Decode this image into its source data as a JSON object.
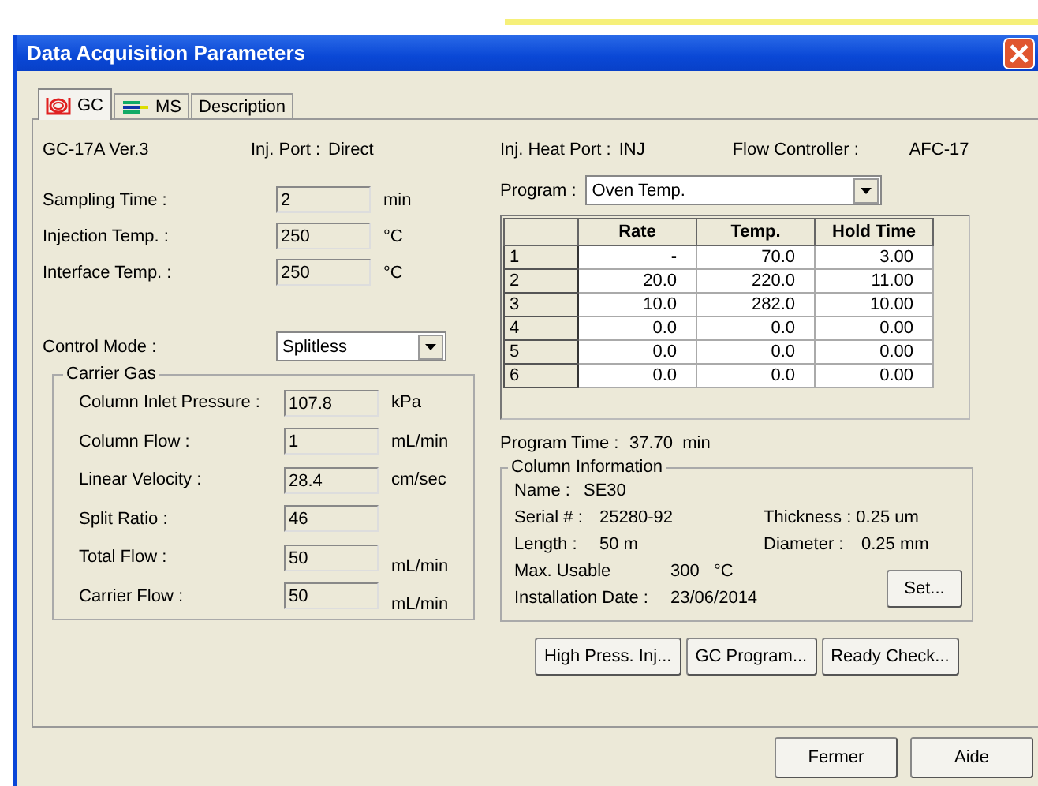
{
  "window": {
    "title": "Data Acquisition Parameters"
  },
  "tabs": [
    {
      "label": "GC",
      "kind": "gc",
      "selected": true
    },
    {
      "label": "MS",
      "kind": "ms",
      "selected": false
    },
    {
      "label": "Description",
      "kind": "text",
      "selected": false
    }
  ],
  "header": {
    "model": "GC-17A Ver.3",
    "inj_port_label": "Inj. Port :",
    "inj_port": "Direct",
    "heat_port_label": "Inj. Heat Port :",
    "heat_port": "INJ",
    "flow_controller_label": "Flow Controller :",
    "flow_controller": "AFC-17"
  },
  "fields": [
    {
      "label": "Sampling Time :",
      "value": "2",
      "unit": "min"
    },
    {
      "label": "Injection Temp. :",
      "value": "250",
      "unit": "°C"
    },
    {
      "label": "Interface Temp. :",
      "value": "250",
      "unit": "°C"
    }
  ],
  "control_mode": {
    "label": "Control Mode :",
    "value": "Splitless"
  },
  "carrier_gas": {
    "title": "Carrier Gas",
    "fields": [
      {
        "label": "Column Inlet Pressure :",
        "value": "107.8",
        "unit": "kPa"
      },
      {
        "label": "Column Flow :",
        "value": "1",
        "unit": "mL/min"
      },
      {
        "label": "Linear Velocity :",
        "value": "28.4",
        "unit": "cm/sec"
      },
      {
        "label": "Split Ratio :",
        "value": "46"
      },
      {
        "label": "Total Flow :",
        "value": "50",
        "unit": "mL/min"
      },
      {
        "label": "Carrier Flow :",
        "value": "50",
        "unit": "mL/min"
      }
    ]
  },
  "program": {
    "label": "Program :",
    "value": "Oven Temp."
  },
  "table": {
    "columns": [
      "Rate",
      "Temp.",
      "Hold Time"
    ],
    "rows": [
      {
        "index": "1",
        "cells": [
          "-",
          "70.0",
          "3.00"
        ]
      },
      {
        "index": "2",
        "cells": [
          "20.0",
          "220.0",
          "11.00"
        ]
      },
      {
        "index": "3",
        "cells": [
          "10.0",
          "282.0",
          "10.00"
        ]
      },
      {
        "index": "4",
        "cells": [
          "0.0",
          "0.0",
          "0.00"
        ]
      },
      {
        "index": "5",
        "cells": [
          "0.0",
          "0.0",
          "0.00"
        ]
      },
      {
        "index": "6",
        "cells": [
          "0.0",
          "0.0",
          "0.00"
        ]
      }
    ]
  },
  "program_time": {
    "label": "Program Time :",
    "value": "37.70  min"
  },
  "column_information": {
    "title": "Column Information",
    "name_label": "Name :",
    "name": "SE30",
    "serial_label": "Serial # :",
    "serial": "25280-92",
    "thickness": "Thickness : 0.25 um",
    "length_label": "Length :",
    "length": "50 m",
    "diameter_label": "Diameter :",
    "diameter": "0.25 mm",
    "max_label": "Max. Usable",
    "max": "300   °C",
    "date_label": "Installation Date :",
    "date": "23/06/2014",
    "set_button": "Set..."
  },
  "action_buttons": [
    "High Press. Inj...",
    "GC Program...",
    "Ready Check..."
  ],
  "footer_buttons": [
    "Fermer",
    "Aide"
  ]
}
